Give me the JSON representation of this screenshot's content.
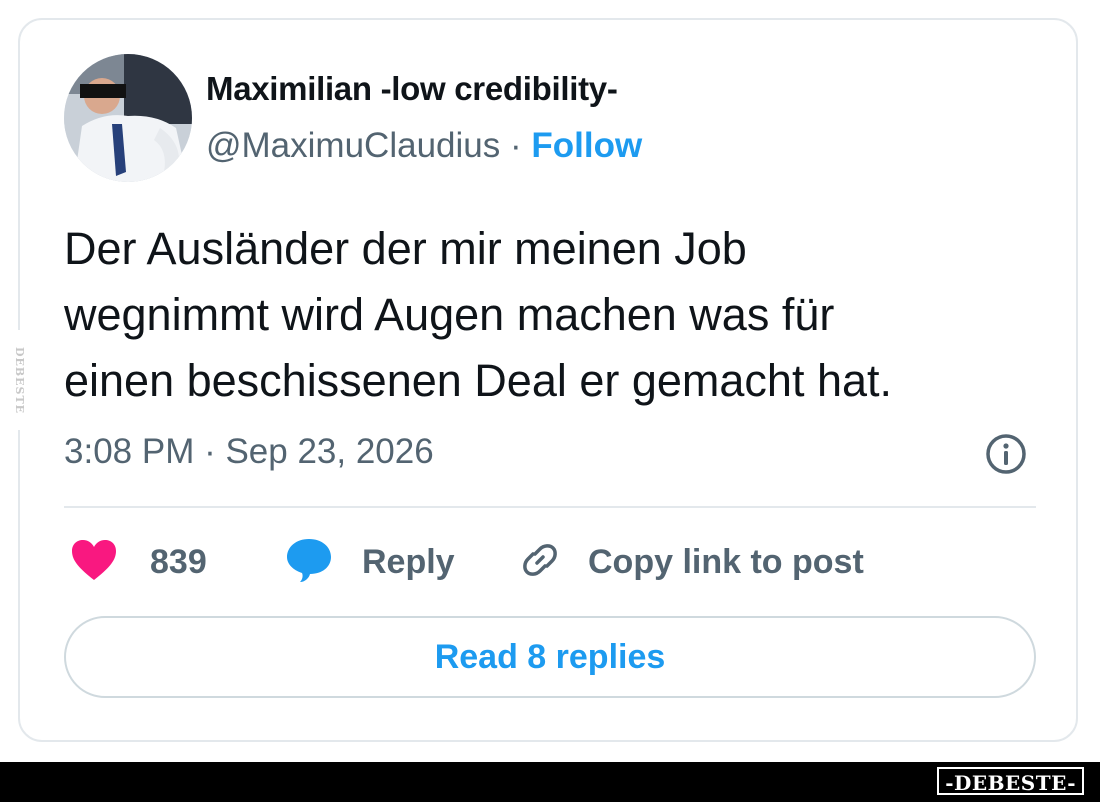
{
  "author": {
    "name": "Maximilian -low credibility-",
    "handle": "@MaximuClaudius",
    "separator": "·",
    "follow_label": "Follow"
  },
  "tweet": {
    "lines": [
      "Der Ausländer der mir meinen Job",
      "wegnimmt wird Augen machen was für",
      "einen beschissenen Deal er gemacht hat."
    ],
    "timestamp": "3:08 PM · Sep 23, 2026"
  },
  "actions": {
    "likes_count": "839",
    "reply_label": "Reply",
    "copy_link_label": "Copy link to post"
  },
  "read_replies_label": "Read 8 replies",
  "watermarks": {
    "side": "DEBESTE",
    "bottom": "-DEBESTE-"
  },
  "colors": {
    "heart": "#f91880",
    "reply_bubble": "#1d9bf0",
    "link": "#1d9bf0",
    "secondary_text": "#536471",
    "primary_text": "#0f1419"
  },
  "icons": {
    "like": "heart-icon",
    "reply": "speech-bubble-icon",
    "copy": "link-icon",
    "info": "info-icon"
  }
}
